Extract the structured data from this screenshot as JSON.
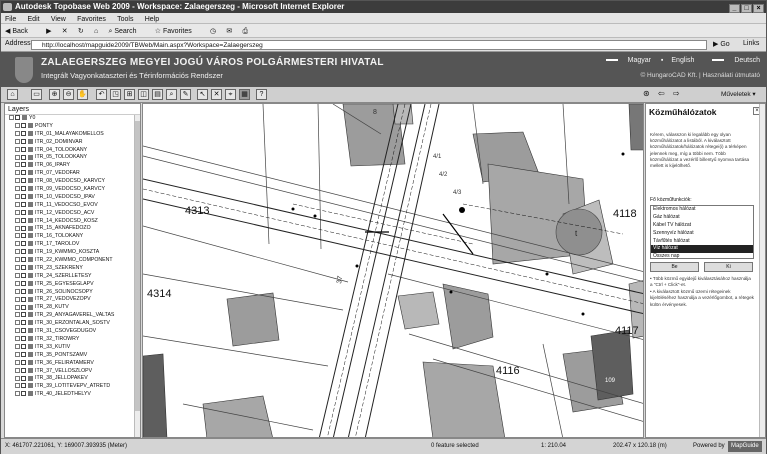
{
  "window": {
    "title": "Autodesk Topobase Web 2009 - Workspace: Zalaegerszeg - Microsoft Internet Explorer",
    "controls": [
      "_",
      "□",
      "×"
    ]
  },
  "menu": [
    "File",
    "Edit",
    "View",
    "Favorites",
    "Tools",
    "Help"
  ],
  "browser_toolbar": {
    "back": "Back",
    "search": "Search",
    "favorites": "Favorites"
  },
  "address": {
    "label": "Address",
    "url": "http://localhost/mapguide2009/TBWeb/Main.aspx?Workspace=Zalaegerszeg",
    "go": "Go",
    "links": "Links"
  },
  "banner": {
    "title": "ZALAEGERSZEG MEGYEI JOGÚ VÁROS POLGÁRMESTERI HIVATAL",
    "subtitle": "Integrált Vagyonkataszteri és Térinformációs Rendszer",
    "langs": [
      "Magyar",
      "English",
      "Deutsch"
    ],
    "copyright": "© HungaroCAD Kft. | Használati útmutató"
  },
  "app_toolbar": {
    "tools": [
      "⌂",
      "▭",
      "⊕",
      "⊖",
      "✋",
      "↶",
      "◳",
      "⊞",
      "◫",
      "▤",
      "⌕",
      "✎",
      "↖",
      "✕",
      "⌖",
      "▦",
      "?"
    ],
    "task_menu": "Műveletek ▾"
  },
  "layers": {
    "header": "Layers",
    "items": [
      "Y0",
      "PONTY",
      "ITR_01_MALAYAKOMELLOS",
      "ITR_02_DOMINVAR",
      "ITR_04_TOLOOKANY",
      "ITR_05_TOLOOKANY",
      "ITR_06_IPARY",
      "ITR_07_VEDOFAR",
      "ITR_08_VEDOCSO_KARVCY",
      "ITR_09_VEDOCSO_KARVCY",
      "ITR_10_VEDOCSO_IPAV",
      "ITR_11_VEDOCSO_EVOV",
      "ITR_12_VEDOCSO_ACV",
      "ITR_14_KEDOCSO_KOSZ",
      "ITR_15_AKNAFEDOZO",
      "ITR_16_TOLOKANY",
      "ITR_17_TAROLOV",
      "ITR_19_KWMMO_KOSZTA",
      "ITR_22_KWMMO_COMPONENT",
      "ITR_23_SZEKRENY",
      "ITR_24_SZERLLETESY",
      "ITR_25_EGYESEGLAPV",
      "ITR_26_SOLINOCSOPY",
      "ITR_27_VEDOVEZOPV",
      "ITR_28_KUTV",
      "ITR_29_ANYAGAVEREL_VALTAS",
      "ITR_30_ERZONTALAN_SOSTV",
      "ITR_31_CSOVEGDUGOV",
      "ITR_32_TIROWRY",
      "ITR_33_KUTIV",
      "ITR_35_PONTSZAMV",
      "ITR_36_FELIRATAMERV",
      "ITR_37_VELLOSZLOPV",
      "ITR_38_JELLOPAKEV",
      "ITR_39_LOTITEVEPV_ATRETD",
      "ITR_40_JELEDTHELYV"
    ]
  },
  "map": {
    "parcels": [
      "4313",
      "4314",
      "4116",
      "4117",
      "4118"
    ],
    "small_labels": [
      "37",
      "8",
      "4/1",
      "4/2",
      "4/3",
      "t",
      "109"
    ]
  },
  "panel": {
    "title": "Közműhálózatok",
    "close": "×",
    "intro": "Kérem, válasszon ki legalább egy olyan közműhálózatot a listából. A kiválasztott közműhálózatok/hálózatok rétegei(i) a térképen jelennek meg, míg a többi nem. Több közműhálózat a vezérlő billentyű nyomva tartása mellett is kijelölhető.",
    "select_label": "Fő közműfunkciók:",
    "options": [
      "Elektromos hálózat",
      "Gáz hálózat",
      "Kábel TV hálózat",
      "Szennyvíz hálózat",
      "Távfűtés hálózat",
      "Víz hálózat",
      "Összes nap"
    ],
    "selected_index": 5,
    "buttons": [
      "Be",
      "Ki"
    ],
    "hints": [
      "Több közmű egyidejű kiválasztásához használja a \"Ctrl + Click\"-et.",
      "A kiválasztott közmű üzemi rétegeinek kijelöléséhez használja a vezérlőgombot, a rétegek külön érvényesek."
    ]
  },
  "status": {
    "coords": "X: 461707.221061, Y: 169007.393935 (Meter)",
    "features": "0 feature selected",
    "scale": "1: 210.04",
    "size": "202.47 x 120.18 (m)",
    "powered": "Powered by",
    "mapguide": "MapGuide"
  }
}
